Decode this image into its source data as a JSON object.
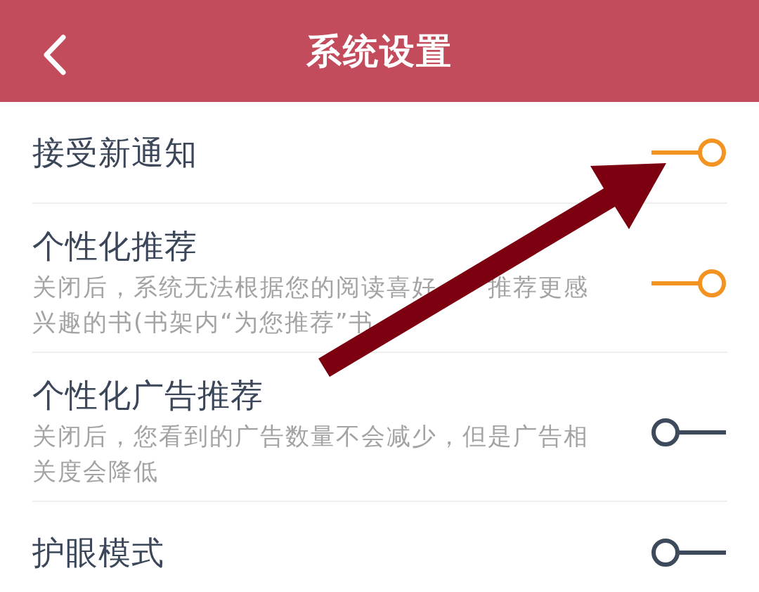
{
  "header": {
    "title": "系统设置"
  },
  "settings": [
    {
      "title": "接受新通知",
      "on": true
    },
    {
      "title": "个性化推荐",
      "description_lines": [
        [
          "关闭后，系统无法根据您的阅读喜好",
          "推荐更感"
        ],
        [
          "兴趣的书(书架内“为您推荐”书"
        ]
      ],
      "on": true
    },
    {
      "title": "个性化广告推荐",
      "description": "关闭后，您看到的广告数量不会减少，但是广告相关度会降低",
      "on": false
    },
    {
      "title": "护眼模式",
      "on": false
    }
  ]
}
